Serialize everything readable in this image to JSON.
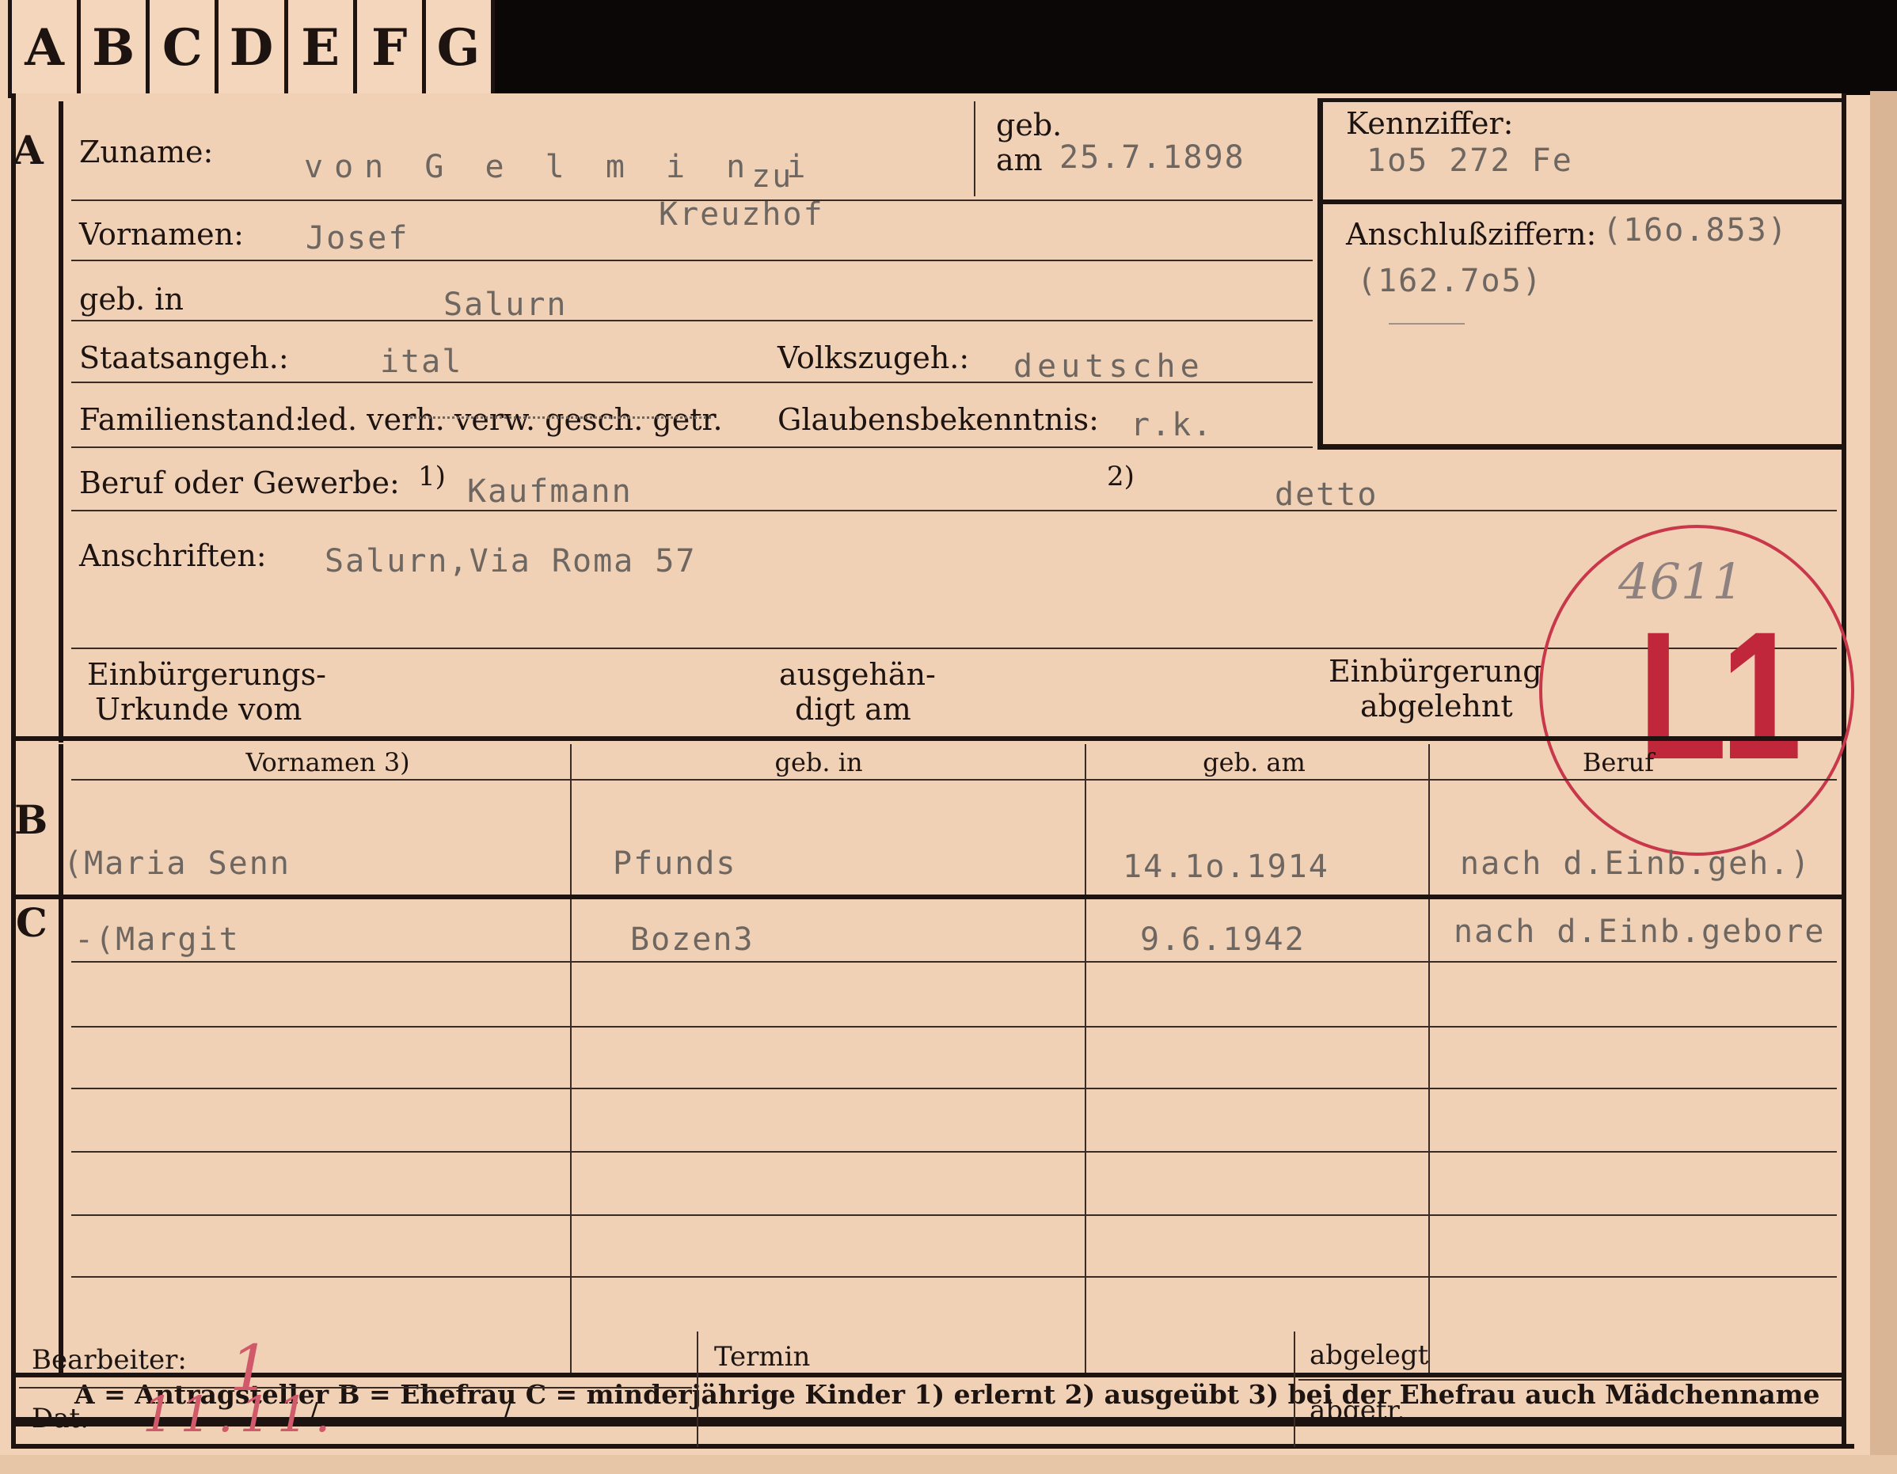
{
  "tabs": [
    "A",
    "B",
    "C",
    "D",
    "E",
    "F",
    "G"
  ],
  "sections": {
    "a": "A",
    "b": "B",
    "c": "C"
  },
  "labels": {
    "zuname": "Zuname:",
    "geb": "geb.",
    "am": "am",
    "kennziffer": "Kennziffer:",
    "vornamen": "Vornamen:",
    "anschlussziffern": "Anschlußziffern:",
    "geb_in": "geb. in",
    "staatsangeh": "Staatsangeh.:",
    "volkszugeh": "Volkszugeh.:",
    "familienstand": "Familienstand:",
    "familienstand_options": "led. verh. verw. gesch. getr.",
    "glaubensbekenntnis": "Glaubensbekenntnis:",
    "beruf": "Beruf oder Gewerbe:",
    "fn1": "1)",
    "fn2": "2)",
    "anschriften": "Anschriften:",
    "einb_urkunde_1": "Einbürgerungs-",
    "einb_urkunde_2": "Urkunde vom",
    "ausgehaendigt_1": "ausgehän-",
    "ausgehaendigt_2": "digt am",
    "einb_abgelehnt_1": "Einbürgerung",
    "einb_abgelehnt_2": "abgelehnt"
  },
  "values": {
    "zuname": "von  G e l m i n i",
    "zuname_zu": "zu",
    "zuname_kreuzhof": "Kreuzhof",
    "geb_am": "25.7.1898",
    "kennziffer": "1o5 272 Fe",
    "vornamen": "Josef",
    "anschluss_1": "(16o.853)",
    "anschluss_2": "(162.7o5)",
    "geb_in": "Salurn",
    "staatsangeh": "ital",
    "volkszugeh": "deutsche",
    "glaubensbekenntnis": "r.k.",
    "beruf_erlernt": "Kaufmann",
    "beruf_ausgeuebt": "detto",
    "anschriften": "Salurn,Via Roma 57"
  },
  "stamp": {
    "text": "L1",
    "number": "4611",
    "color": "#c0273a"
  },
  "family_headers": {
    "vornamen": "Vornamen 3)",
    "geb_in": "geb. in",
    "geb_am": "geb. am",
    "beruf": "Beruf"
  },
  "spouse": {
    "vornamen": "(Maria Senn",
    "geb_in": "Pfunds",
    "geb_am": "14.1o.1914",
    "beruf": "nach d.Einb.geh.)"
  },
  "children": [
    {
      "vornamen": "-(Margit",
      "geb_in": "Bozen3",
      "geb_am": "9.6.1942",
      "beruf": "nach d.Einb.gebore"
    }
  ],
  "legend": "A = Antragsteller   B = Ehefrau   C = minderjährige Kinder   1) erlernt   2) ausgeübt   3) bei der Ehefrau auch Mädchenname",
  "footer": {
    "bearbeiter": "Bearbeiter:",
    "dat": "Dat.",
    "termin": "Termin",
    "abgelegt": "abgelegt",
    "abgetr": "abgetr.",
    "bearbeiter_hand": "1",
    "dat_hand": "11.11.",
    "slash": "/"
  }
}
